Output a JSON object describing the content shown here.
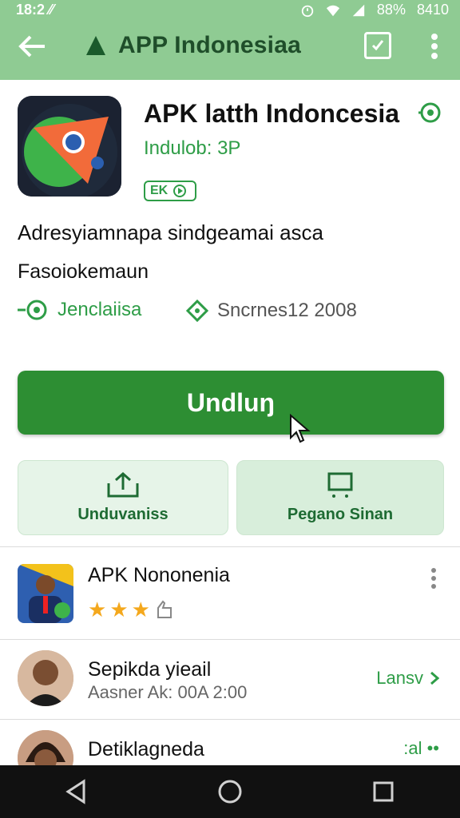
{
  "status": {
    "time": "18:2 ⁄⁄",
    "battery": "88%",
    "clock_right": "8410"
  },
  "appbar": {
    "title": "APP Indonesiaa"
  },
  "app": {
    "title": "APK latth Indoncesia",
    "subtitle": "Indulob: 3P",
    "badge": "EK",
    "description": "Adresyiamnapa sindgeamai asca",
    "publisher": "Fasoiokemaun",
    "meta_left": "Jenclaiisa",
    "meta_right": "Sncrnes12 2008"
  },
  "buttons": {
    "download": "Undluŋ",
    "tile_left": "Unduvaniss",
    "tile_right": "Pegano Sinan"
  },
  "list": [
    {
      "title": "APK Nononenia",
      "rating": 3
    },
    {
      "title": "Sepikda yieail",
      "subtitle": "Aasner Ak: 00A 2:00",
      "action": "Lansv"
    },
    {
      "title": "Detiklagneda",
      "action": ":al ••"
    }
  ],
  "colors": {
    "primary": "#2d8e33",
    "appbar": "#8fcb93",
    "tile": "#e6f4e8",
    "accent_text": "#2e9d47",
    "star": "#f4a81d"
  },
  "icons": {
    "back": "arrow-left-icon",
    "brand": "triangle-icon",
    "edit": "check-square-icon",
    "more": "more-vert-icon",
    "verified": "target-icon",
    "upload": "upload-icon",
    "desktop": "monitor-icon"
  }
}
